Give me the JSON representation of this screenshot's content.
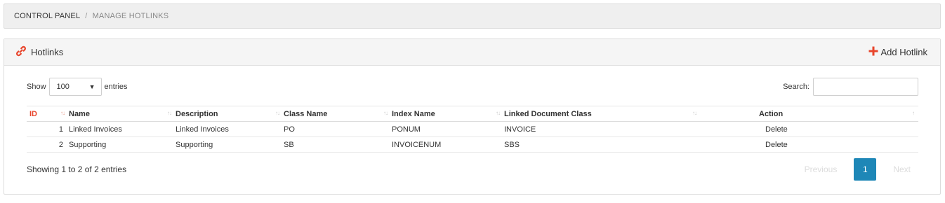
{
  "breadcrumb": {
    "root": "CONTROL PANEL",
    "separator": "/",
    "current": "MANAGE HOTLINKS"
  },
  "panel": {
    "title": "Hotlinks",
    "title_icon": "link-icon",
    "add_label": "Add Hotlink",
    "add_icon": "plus-icon",
    "accent_color": "#e8452c"
  },
  "controls": {
    "show_label": "Show",
    "page_size": "100",
    "entries_label": "entries",
    "search_label": "Search:",
    "search_value": ""
  },
  "table": {
    "columns": [
      "ID",
      "Name",
      "Description",
      "Class Name",
      "Index Name",
      "Linked Document Class",
      "Action"
    ],
    "rows": [
      {
        "id": "1",
        "name": "Linked Invoices",
        "description": "Linked Invoices",
        "class_name": "PO",
        "index_name": "PONUM",
        "linked_class": "INVOICE",
        "action": "Delete"
      },
      {
        "id": "2",
        "name": "Supporting",
        "description": "Supporting",
        "class_name": "SB",
        "index_name": "INVOICENUM",
        "linked_class": "SBS",
        "action": "Delete"
      }
    ]
  },
  "footer": {
    "info": "Showing 1 to 2 of 2 entries",
    "prev_label": "Previous",
    "current_page": "1",
    "next_label": "Next",
    "page_color": "#1e87b7"
  }
}
